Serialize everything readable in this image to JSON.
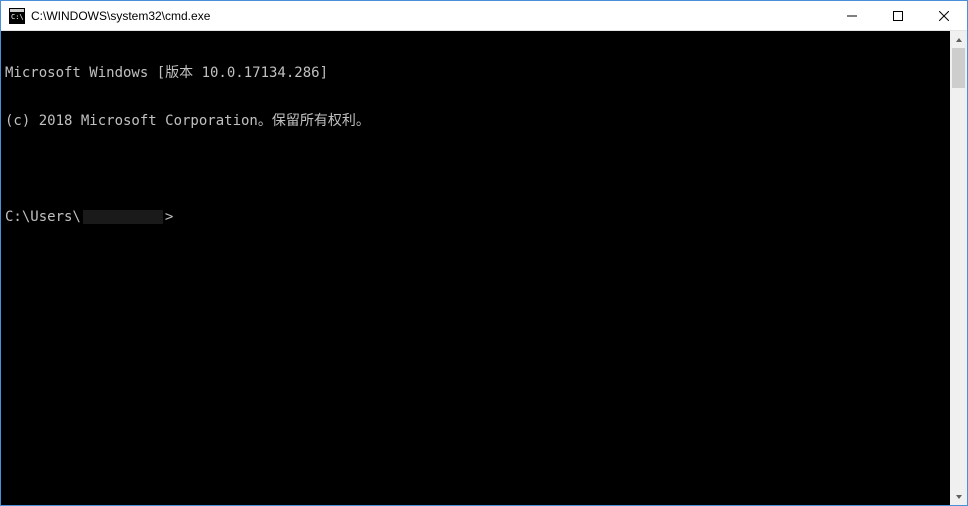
{
  "titlebar": {
    "title": "C:\\WINDOWS\\system32\\cmd.exe"
  },
  "console": {
    "line1": "Microsoft Windows [版本 10.0.17134.286]",
    "line2": "(c) 2018 Microsoft Corporation。保留所有权利。",
    "prompt_prefix": "C:\\Users\\",
    "prompt_suffix": ">"
  }
}
